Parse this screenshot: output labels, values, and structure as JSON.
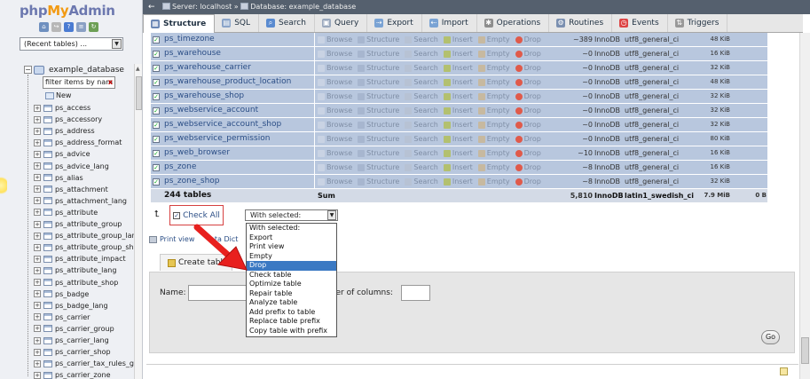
{
  "nav": {
    "logo_php": "php",
    "logo_my": "My",
    "logo_admin": "Admin",
    "recent_tables": "(Recent tables) ...",
    "database": "example_database",
    "filter_placeholder": "filter items by nam",
    "new_label": "New",
    "tables": [
      "ps_access",
      "ps_accessory",
      "ps_address",
      "ps_address_format",
      "ps_advice",
      "ps_advice_lang",
      "ps_alias",
      "ps_attachment",
      "ps_attachment_lang",
      "ps_attribute",
      "ps_attribute_group",
      "ps_attribute_group_lan",
      "ps_attribute_group_sho",
      "ps_attribute_impact",
      "ps_attribute_lang",
      "ps_attribute_shop",
      "ps_badge",
      "ps_badge_lang",
      "ps_carrier",
      "ps_carrier_group",
      "ps_carrier_lang",
      "ps_carrier_shop",
      "ps_carrier_tax_rules_g",
      "ps_carrier_zone"
    ]
  },
  "breadcrumb": {
    "server": "Server: localhost",
    "sep": " » ",
    "database": "Database: example_database"
  },
  "tabs": [
    "Structure",
    "SQL",
    "Search",
    "Query",
    "Export",
    "Import",
    "Operations",
    "Routines",
    "Events",
    "Triggers"
  ],
  "actions": [
    "Browse",
    "Structure",
    "Search",
    "Insert",
    "Empty",
    "Drop"
  ],
  "table_rows": [
    {
      "name": "ps_timezone",
      "rows": "~389",
      "engine": "InnoDB",
      "collation": "utf8_general_ci",
      "size": "48 KiB"
    },
    {
      "name": "ps_warehouse",
      "rows": "~0",
      "engine": "InnoDB",
      "collation": "utf8_general_ci",
      "size": "16 KiB"
    },
    {
      "name": "ps_warehouse_carrier",
      "rows": "~0",
      "engine": "InnoDB",
      "collation": "utf8_general_ci",
      "size": "32 KiB"
    },
    {
      "name": "ps_warehouse_product_location",
      "rows": "~0",
      "engine": "InnoDB",
      "collation": "utf8_general_ci",
      "size": "48 KiB"
    },
    {
      "name": "ps_warehouse_shop",
      "rows": "~0",
      "engine": "InnoDB",
      "collation": "utf8_general_ci",
      "size": "32 KiB"
    },
    {
      "name": "ps_webservice_account",
      "rows": "~0",
      "engine": "InnoDB",
      "collation": "utf8_general_ci",
      "size": "32 KiB"
    },
    {
      "name": "ps_webservice_account_shop",
      "rows": "~0",
      "engine": "InnoDB",
      "collation": "utf8_general_ci",
      "size": "32 KiB"
    },
    {
      "name": "ps_webservice_permission",
      "rows": "~0",
      "engine": "InnoDB",
      "collation": "utf8_general_ci",
      "size": "80 KiB"
    },
    {
      "name": "ps_web_browser",
      "rows": "~10",
      "engine": "InnoDB",
      "collation": "utf8_general_ci",
      "size": "16 KiB"
    },
    {
      "name": "ps_zone",
      "rows": "~8",
      "engine": "InnoDB",
      "collation": "utf8_general_ci",
      "size": "16 KiB"
    },
    {
      "name": "ps_zone_shop",
      "rows": "~8",
      "engine": "InnoDB",
      "collation": "utf8_general_ci",
      "size": "32 KiB"
    }
  ],
  "summary": {
    "tables": "244 tables",
    "sum": "Sum",
    "rows": "5,810",
    "engine": "InnoDB",
    "collation": "latin1_swedish_ci",
    "size": "7.9 MiB",
    "overhead": "0 B"
  },
  "bulk": {
    "check_all": "Check All",
    "with_selected": "With selected:",
    "options": [
      "With selected:",
      "Export",
      "Print view",
      "Empty",
      "Drop",
      "Check table",
      "Optimize table",
      "Repair table",
      "Analyze table",
      "Add prefix to table",
      "Replace table prefix",
      "Copy table with prefix"
    ],
    "selected_option": "Drop",
    "print_view": "Print view",
    "data_dict": "ata Dict"
  },
  "create": {
    "button": "Create table",
    "name_label": "Name:",
    "cols_label": "mber of columns:",
    "go": "Go"
  },
  "colors": {
    "row_bg": "#b8c7de",
    "accent": "#3b79c3",
    "annotation": "#e8201e"
  }
}
